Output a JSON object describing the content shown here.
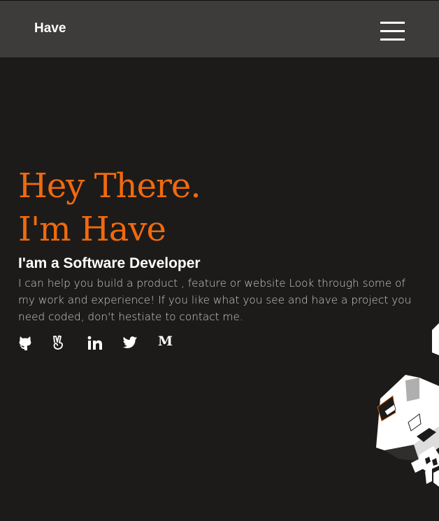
{
  "navbar": {
    "brand": "Have",
    "menu_icon": "hamburger-menu-icon"
  },
  "hero": {
    "greeting": "Hey There.",
    "name_line": "I'm Have",
    "subtitle": "I'am a Software Developer",
    "description": "I can help you build a product , feature or website Look through some of my work and experience! If you like what you see and have a project you need coded, don't hestiate to contact me.",
    "accent_color": "#f06a0f"
  },
  "social": {
    "icons": [
      "github-icon",
      "angellist-icon",
      "linkedin-icon",
      "twitter-icon",
      "medium-icon"
    ],
    "medium_letter": "M"
  },
  "decoration": "isometric-blocks-illustration"
}
